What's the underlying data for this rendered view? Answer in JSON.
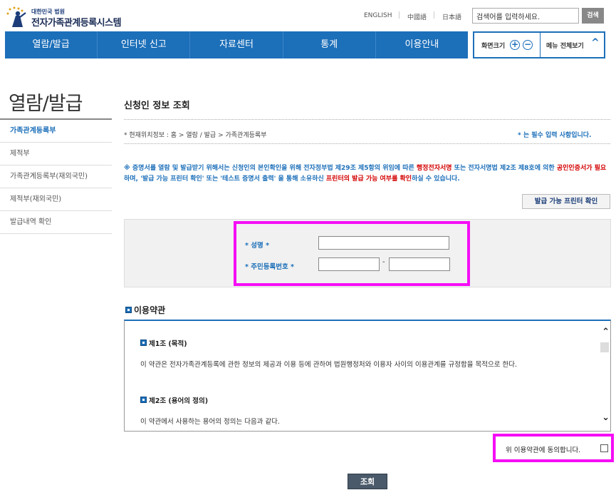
{
  "header": {
    "logo_sub": "대한민국 법원",
    "logo_name": "전자가족관계등록시스템",
    "languages": [
      "ENGLISH",
      "中國語",
      "日本語"
    ],
    "search": {
      "placeholder": "검색어를 입력하세요.",
      "button": "검색"
    }
  },
  "nav": {
    "items": [
      "열람/발급",
      "인터넷 신고",
      "자료센터",
      "통계",
      "이용안내"
    ],
    "zoom_label": "화면크기",
    "zoom_in": "+",
    "zoom_out": "−",
    "menu_all": "메뉴 전체보기"
  },
  "sidebar": {
    "title": "열람/발급",
    "items": [
      "가족관계등록부",
      "제적부",
      "가족관계등록부(재외국민)",
      "제적부(재외국민)",
      "발급내역 확인"
    ]
  },
  "main": {
    "title": "신청인 정보 조회",
    "breadcrumb": "* 현재위치정보 : 홈 > 열람 / 발급 > 가족관계등록부",
    "required_note": "* 는 필수 입력 사항입니다.",
    "notice": {
      "p1": "※ 증명서를 열람 및 발급받기 위해서는 신청인의 본인확인을 위해 전자정부법 제29조 제5항의 위임에 따른 ",
      "r1": "행정전자서명",
      "p2": " 또는 전자서명법 제2조 제8호에 의한 ",
      "r2": "공인인증서가 필요",
      "p3": "하며, '발급 가능 프린터 확인' 또는 '테스트 증명서 출력' 을 통해 소유하신 ",
      "r3": "프린터의 발급 가능 여부를 확인",
      "p4": "하실 수 있습니다."
    },
    "printer_button": "발급 가능 프린터 확인",
    "form": {
      "name_label": "* 성명 *",
      "name_value": "",
      "rrn_label": "* 주민등록번호 *",
      "rrn_front": "",
      "rrn_dash": "-",
      "rrn_back": ""
    },
    "terms": {
      "title": "이용약관",
      "articles": [
        {
          "title": "제1조 (목적)",
          "text": "이 약관은 전자가족관계등록에 관한 정보의 제공과 이용 등에 관하여 법원행정처와 이용자 사이의 이용관계를 규정함을 목적으로 한다."
        },
        {
          "title": "제2조 (용어의 정의)",
          "text": "이 약관에서 사용하는 용어의 정의는 다음과 같다."
        }
      ],
      "scroll_up": "⌃",
      "scroll_down": "⌄"
    },
    "agree_label": "위 이용약관에 동의합니다.",
    "agree_checked": false,
    "submit": "조회"
  }
}
